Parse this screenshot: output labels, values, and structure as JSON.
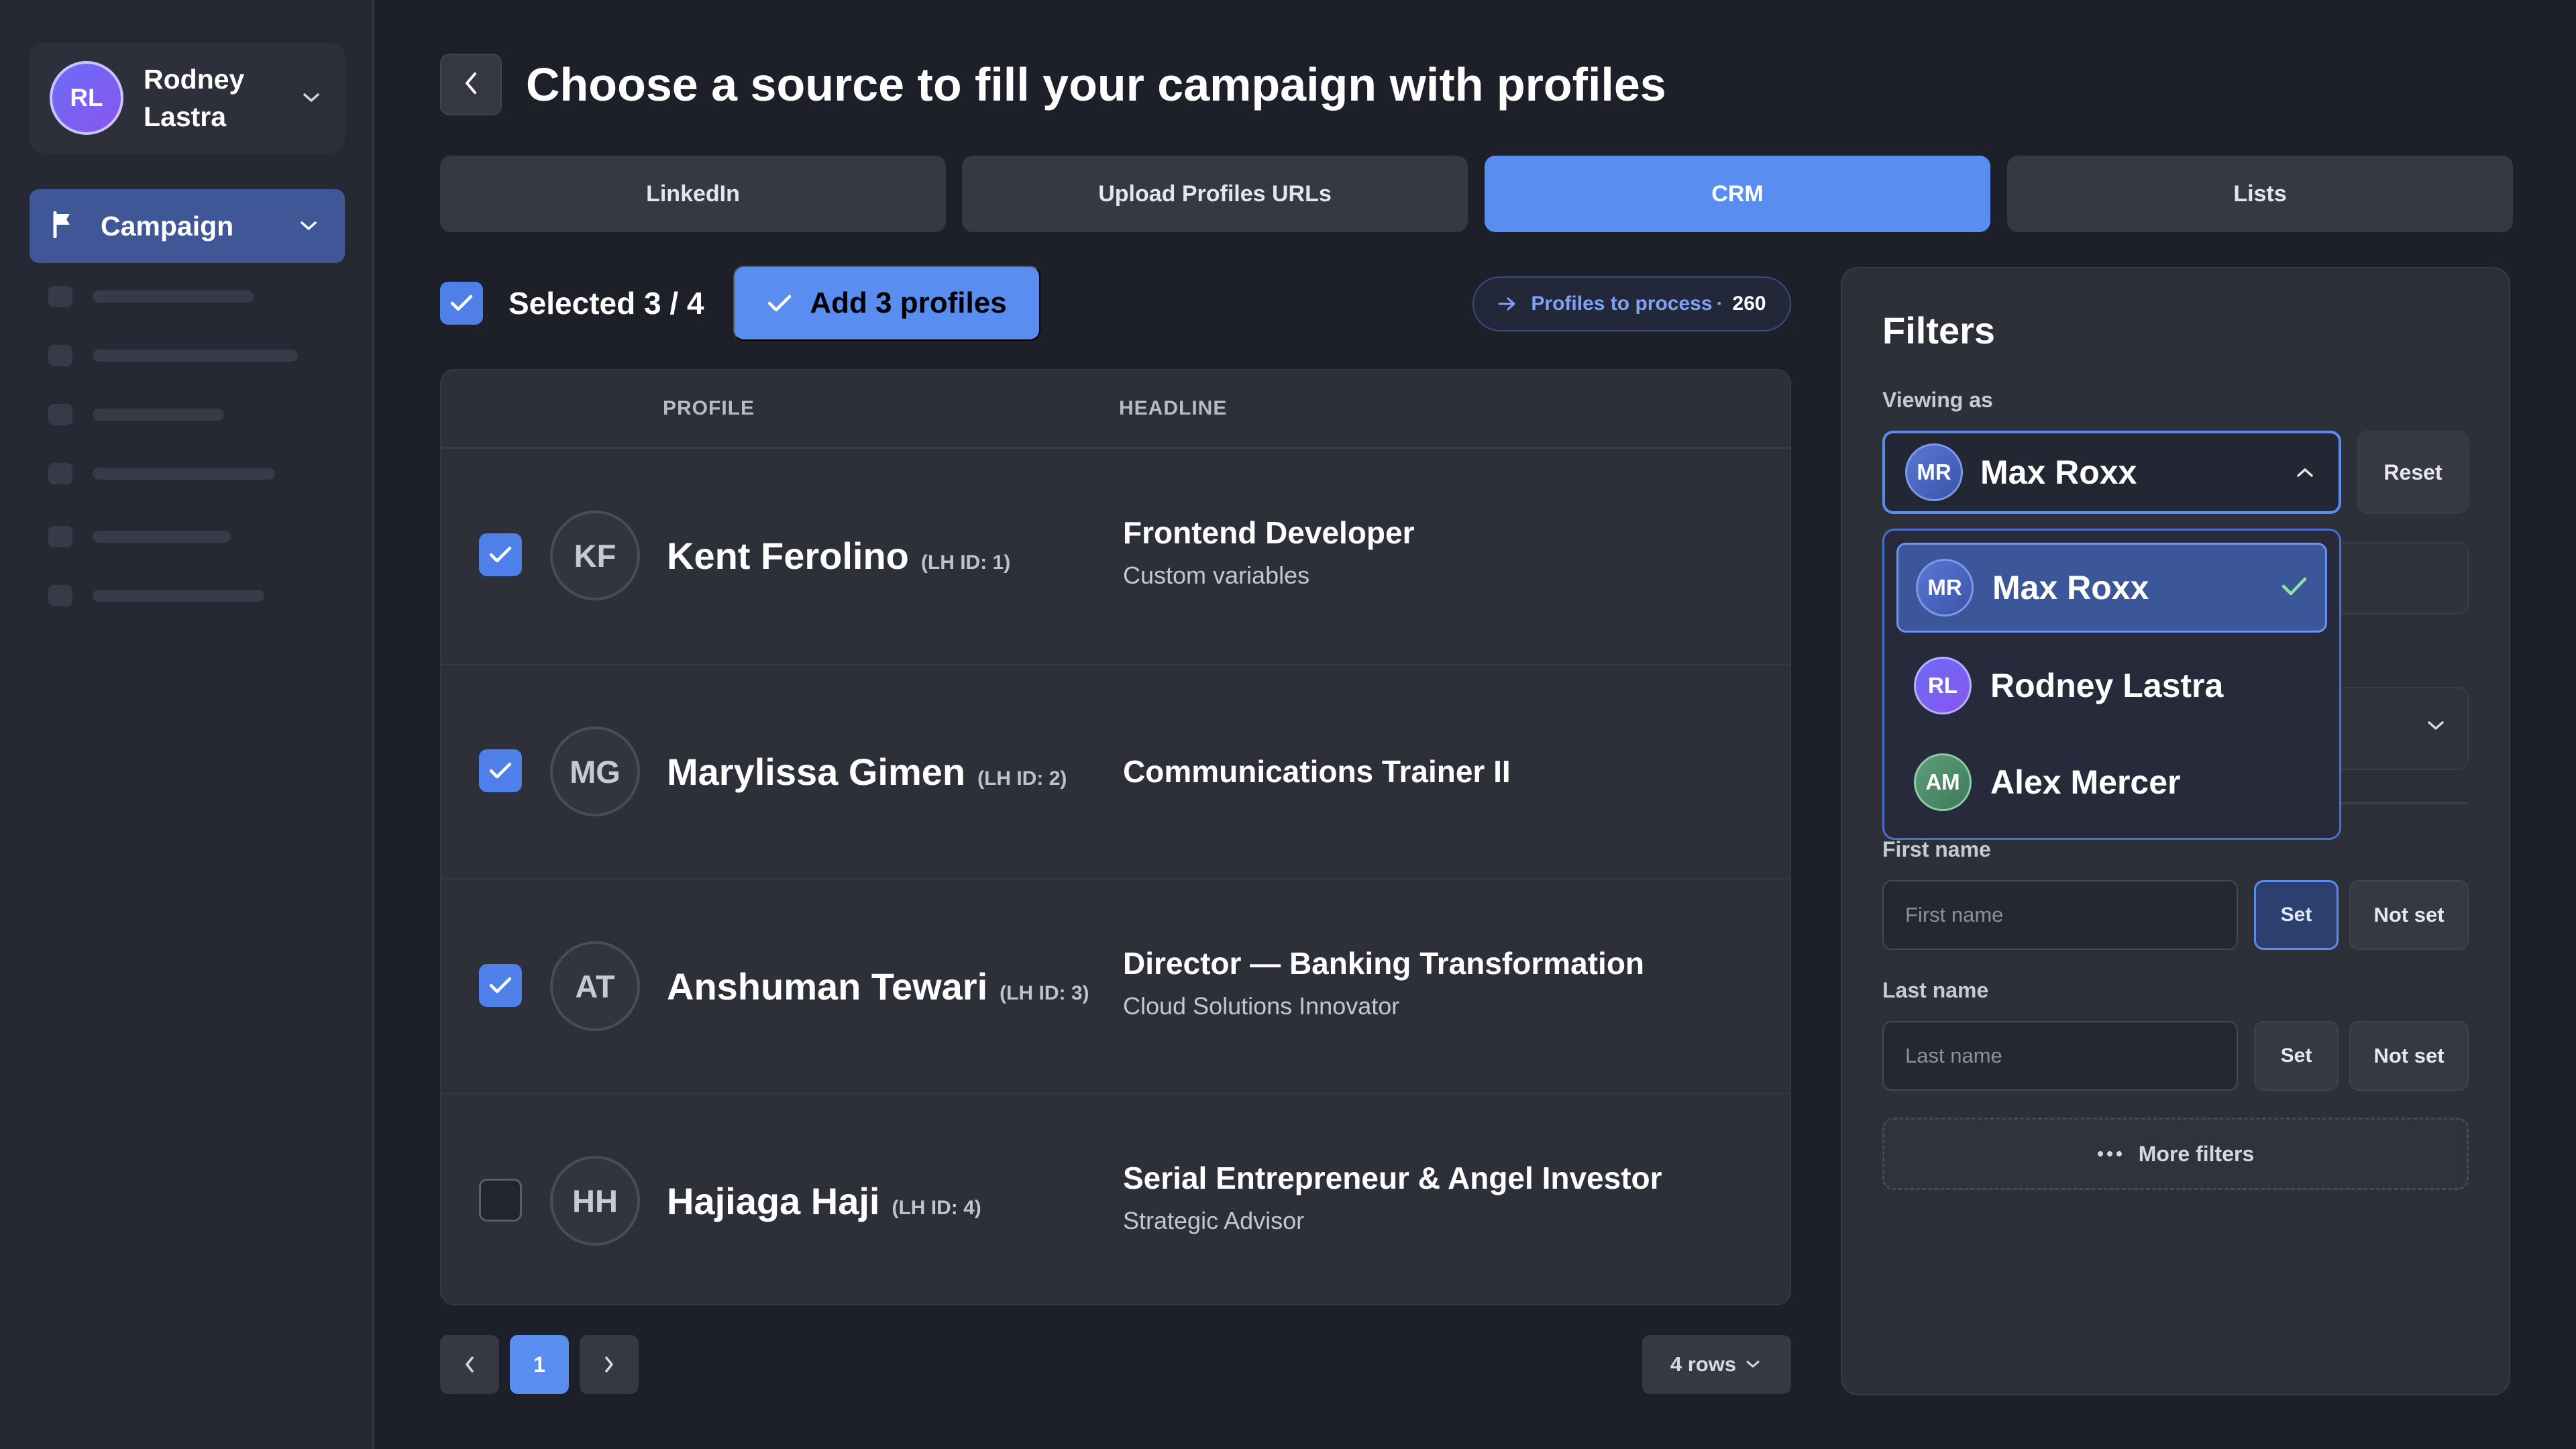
{
  "sidebar": {
    "user": {
      "initials": "RL",
      "name": "Rodney Lastra"
    },
    "campaign_label": "Campaign"
  },
  "header": {
    "title": "Choose a source to fill your campaign with profiles"
  },
  "tabs": [
    {
      "label": "LinkedIn",
      "active": false
    },
    {
      "label": "Upload Profiles URLs",
      "active": false
    },
    {
      "label": "CRM",
      "active": true
    },
    {
      "label": "Lists",
      "active": false
    }
  ],
  "selection": {
    "text": "Selected 3 / 4",
    "add_button": "Add 3 profiles",
    "profiles_to_process_label": "Profiles to process",
    "profiles_to_process_sep": "·",
    "profiles_to_process_count": "260"
  },
  "table": {
    "columns": [
      "PROFILE",
      "HEADLINE"
    ],
    "rows": [
      {
        "initials": "KF",
        "name": "Kent Ferolino",
        "lh_id": "(LH ID: 1)",
        "headline": "Frontend Developer",
        "subheadline": "Custom variables",
        "checked": true
      },
      {
        "initials": "MG",
        "name": "Marylissa Gimen",
        "lh_id": "(LH ID: 2)",
        "headline": "Communications Trainer II",
        "subheadline": "",
        "checked": true
      },
      {
        "initials": "AT",
        "name": "Anshuman Tewari",
        "lh_id": "(LH ID: 3)",
        "headline": "Director — Banking Transformation",
        "subheadline": "Cloud Solutions Innovator",
        "checked": true
      },
      {
        "initials": "HH",
        "name": "Hajiaga Haji",
        "lh_id": "(LH ID: 4)",
        "headline": "Serial Entrepreneur & Angel Investor",
        "subheadline": "Strategic Advisor",
        "checked": false
      }
    ]
  },
  "pagination": {
    "current_page": "1",
    "rows_label": "4 rows"
  },
  "filters": {
    "title": "Filters",
    "viewing_as_label": "Viewing as",
    "viewing_as": {
      "initials": "MR",
      "name": "Max Roxx"
    },
    "reset_label": "Reset",
    "dropdown_options": [
      {
        "initials": "MR",
        "name": "Max Roxx",
        "selected": true
      },
      {
        "initials": "RL",
        "name": "Rodney Lastra",
        "selected": false
      },
      {
        "initials": "AM",
        "name": "Alex Mercer",
        "selected": false
      }
    ],
    "first_name": {
      "label": "First name",
      "placeholder": "First name",
      "set_label": "Set",
      "not_set_label": "Not set"
    },
    "last_name": {
      "label": "Last name",
      "placeholder": "Last name",
      "set_label": "Set",
      "not_set_label": "Not set"
    },
    "more_filters_label": "More filters"
  },
  "colors": {
    "accent": "#5a8df0",
    "background": "#1e2029",
    "panel": "#2d3039"
  }
}
